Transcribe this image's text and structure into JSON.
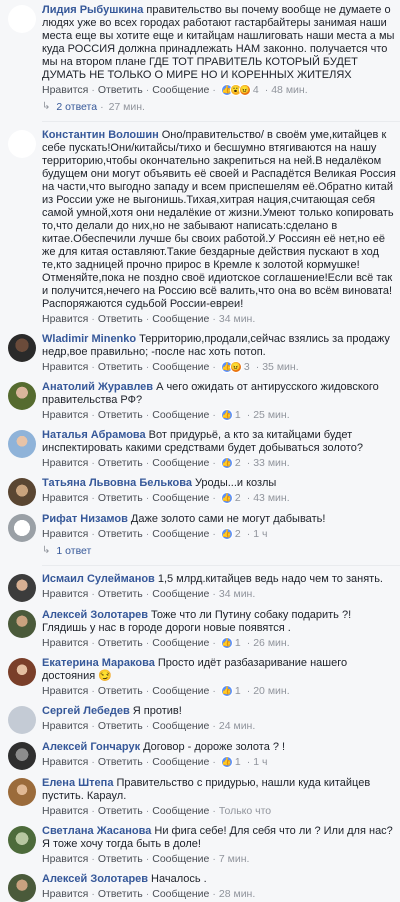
{
  "actions": {
    "like": "Нравится",
    "reply": "Ответить",
    "message": "Сообщение",
    "dot": "·"
  },
  "comments": [
    {
      "author": "Лидия Рыбушкина",
      "text": "правительство вы почему вообще не думаете о людях уже во всех городах работают гастарбайтеры занимая наши места еще вы хотите еще и китайцам нашлиговать наши места а мы куда РОССИЯ должна принадлежать НАМ законно. получается что мы на втором плане ГДЕ ТОТ ПРАВИТЕЛЬ КОТОРЫЙ БУДЕТ ДУМАТЬ НЕ ТОЛЬКО О МИРЕ НО И КОРЕННЫХ ЖИТЕЛЯХ",
      "reactions": "4",
      "time": "48 мин.",
      "replies": "2 ответа",
      "replies_time": "27 мин."
    },
    {
      "author": "Константин Волошин",
      "text": "Оно/правительство/ в своём уме,китайцев к себе пускать!Они/китайсы/тихо и бесшумно втягиваются на нашу территорию,чтобы окончательно закрепиться на ней.В недалёком будущем они могут объявить её своей и Распадётся Великая Россия на части,что выгодно западу и всем приспешелям её.Обратно китай из России уже не выгонишь.Тихая,хитрая нация,считающая себя самой умной,хотя они недалёкие от жизни.Умеют только копировать то,что делали до них,но не забывают написать:сделано в китае.Обеспечили лучше бы своих работой.У Россиян её нет,но её же для китая оставляют.Такие бездарные действия пускают в ход те,кто задницей прочно прирос в Кремле к золотой кормушке! Отменяйте,пока не поздно своё идиотское соглашение!Если всё так и получится,нечего на Россию всё валить,что она во всём виновата! Распоряжаются судьбой России-евреи!",
      "time": "34 мин."
    },
    {
      "author": "Wladimir Minenko",
      "text": "Территорию,продали,сейчас взялись за продажу недр,вое правильно; -после нас хоть потоп.",
      "reactions": "3",
      "time": "35 мин."
    },
    {
      "author": "Анатолий Журавлев",
      "text": "А чего ожидать от антирусского жидовского правительства РФ?",
      "reactions": "1",
      "time": "25 мин."
    },
    {
      "author": "Наталья Абрамова",
      "text": "Вот придурьё, а кто за китайцами будет инспектировать какими средствами будет добываться золото?",
      "reactions": "2",
      "time": "33 мин."
    },
    {
      "author": "Татьяна Львовна Белькова",
      "text": "Уроды...и козлы",
      "reactions": "2",
      "time": "43 мин."
    },
    {
      "author": "Рифат Низамов",
      "text": "Даже золото сами не могут дабывать!",
      "reactions": "2",
      "time": "1 ч",
      "replies": "1 ответ"
    },
    {
      "author": "Исмаил Сулейманов",
      "text": "1,5 млрд.китайцев ведь надо чем то занять.",
      "time": "34 мин."
    },
    {
      "author": "Алексей Золотарев",
      "text": "Тоже что ли Путину собаку подарить ?! Глядишь у нас в городе дороги новые появятся .",
      "reactions": "1",
      "time": "26 мин."
    },
    {
      "author": "Екатерина Маракова",
      "text": "Просто идёт разбазаривание нашего достояния 😏",
      "reactions": "1",
      "time": "20 мин."
    },
    {
      "author": "Сергей Лебедев",
      "text": "Я против!",
      "time": "24 мин."
    },
    {
      "author": "Алексей Гончарук",
      "text": "Договор - дороже золота ? !",
      "reactions": "1",
      "time": "1 ч"
    },
    {
      "author": "Елена Штепа",
      "text": "Правительство с придурью, нашли куда китайцев пустить. Караул.",
      "time": "Только что"
    },
    {
      "author": "Светлана Жасанова",
      "text": "Ни фига себе! Для себя что ли ? Или для нас? Я тоже хочу тогда быть в доле!",
      "time": "7 мин."
    },
    {
      "author": "Алексей Золотарев",
      "text": "Началось .",
      "time": "28 мин."
    }
  ],
  "colors": {
    "link": "#365899",
    "meta": "#90949c",
    "background": "#f6f7f9"
  }
}
